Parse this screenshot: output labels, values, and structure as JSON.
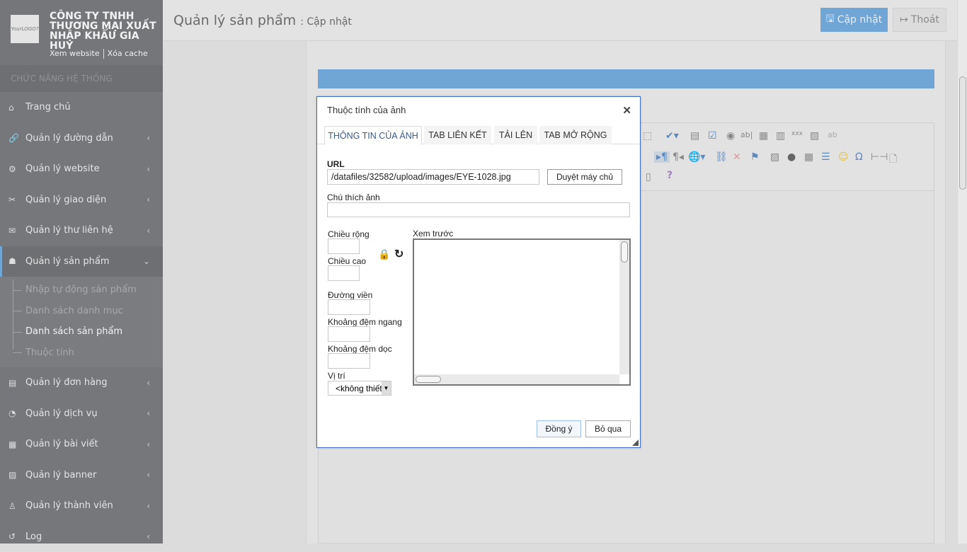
{
  "sidebar": {
    "logo_text": "YourLOGO?",
    "company": "CÔNG TY TNHH THƯƠNG MẠI XUẤT NHẬP KHẨU GIA HUY",
    "view_site": "Xem website",
    "clear_cache": "Xóa cache",
    "section": "CHỨC NĂNG HỆ THỐNG",
    "items": [
      {
        "label": "Trang chủ",
        "icon": "home-icon"
      },
      {
        "label": "Quản lý đường dẫn",
        "icon": "link-icon"
      },
      {
        "label": "Quản lý website",
        "icon": "gears-icon"
      },
      {
        "label": "Quản lý giao diện",
        "icon": "tools-icon"
      },
      {
        "label": "Quản lý thư liên hệ",
        "icon": "envelope-icon"
      },
      {
        "label": "Quản lý sản phẩm",
        "icon": "cubes-icon"
      },
      {
        "label": "Quản lý đơn hàng",
        "icon": "clipboard-icon"
      },
      {
        "label": "Quản lý dịch vụ",
        "icon": "rss-icon"
      },
      {
        "label": "Quản lý bài viết",
        "icon": "newspaper-icon"
      },
      {
        "label": "Quản lý banner",
        "icon": "image-icon"
      },
      {
        "label": "Quản lý thành viên",
        "icon": "user-icon"
      },
      {
        "label": "Log",
        "icon": "history-icon"
      }
    ],
    "sub_items": [
      "Nhập tự động sản phẩm",
      "Danh sách danh mục",
      "Danh sách sản phẩm",
      "Thuộc tính"
    ]
  },
  "header": {
    "title": "Quản lý sản phẩm",
    "subtitle": ": Cập nhật",
    "update": "Cập nhật",
    "exit": "Thoát"
  },
  "dialog": {
    "title": "Thuộc tính của ảnh",
    "tabs": [
      "THÔNG TIN CỦA ẢNH",
      "TAB LIÊN KẾT",
      "TẢI LÊN",
      "TAB MỞ RỘNG"
    ],
    "url_label": "URL",
    "url_value": "/datafiles/32582/upload/images/EYE-1028.jpg",
    "browse": "Duyệt máy chủ",
    "alt_label": "Chú thích ảnh",
    "alt_value": "",
    "width_label": "Chiều rộng",
    "height_label": "Chiều cao",
    "border_label": "Đường viền",
    "hspace_label": "Khoảng đệm ngang",
    "vspace_label": "Khoảng đệm dọc",
    "align_label": "Vị trí",
    "align_value": "<không thiết lập>",
    "preview_label": "Xem trước",
    "ok": "Đồng ý",
    "cancel": "Bỏ qua"
  },
  "colors": {
    "accent": "#6fa6d6",
    "sidebar": "#75777a",
    "dialog_border": "#3c6fbf"
  }
}
